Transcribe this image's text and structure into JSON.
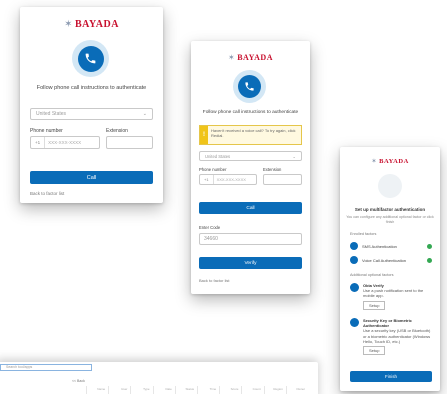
{
  "brand": {
    "name": "BAYADA",
    "color": "#c8102e",
    "accent": "#0a6cb8"
  },
  "card1": {
    "title": "Follow phone call instructions to authenticate",
    "country": "United States",
    "phone_label": "Phone number",
    "extension_label": "Extension",
    "phone_prefix": "+1",
    "phone_placeholder": "XXX-XXX-XXXX",
    "call_button": "Call",
    "back_link": "Back to factor list"
  },
  "card2": {
    "title": "Follow phone call instructions to authenticate",
    "warning": "Haven't received a voice call? To try again, click Redial.",
    "country": "United States",
    "phone_label": "Phone number",
    "extension_label": "Extension",
    "phone_prefix": "+1",
    "phone_value": "XXX-XXX-XXXX",
    "call_button": "Call",
    "code_label": "Enter Code",
    "code_value": "34660",
    "verify_button": "Verify",
    "back_link": "Back to factor list"
  },
  "card3": {
    "title": "Set up multifactor authentication",
    "subtitle": "You can configure any additional optional factor or click finish",
    "enrolled_heading": "Enrolled factors",
    "enrolled": [
      {
        "icon": "sms-icon",
        "label": "SMS Authentication"
      },
      {
        "icon": "phone-icon",
        "label": "Voice Call Authentication"
      }
    ],
    "optional_heading": "Additional optional factors",
    "optional": [
      {
        "icon": "okta-verify-icon",
        "title": "Okta Verify",
        "desc": "Use a push notification sent to the mobile app.",
        "button": "Setup"
      },
      {
        "icon": "security-key-icon",
        "title": "Security Key or Biometric Authenticator",
        "desc": "Use a security key (USB or Bluetooth) or a biometric authenticator (Windows Hello, Touch ID, etc.)",
        "button": "Setup"
      }
    ],
    "finish_button": "Finish"
  },
  "table": {
    "search_placeholder": "Search tool/apps",
    "nav_label": "<< Back",
    "columns": [
      "Name",
      "User",
      "Type",
      "Date",
      "Status",
      "Time",
      "Score",
      "Count",
      "Region",
      "Owner"
    ]
  }
}
